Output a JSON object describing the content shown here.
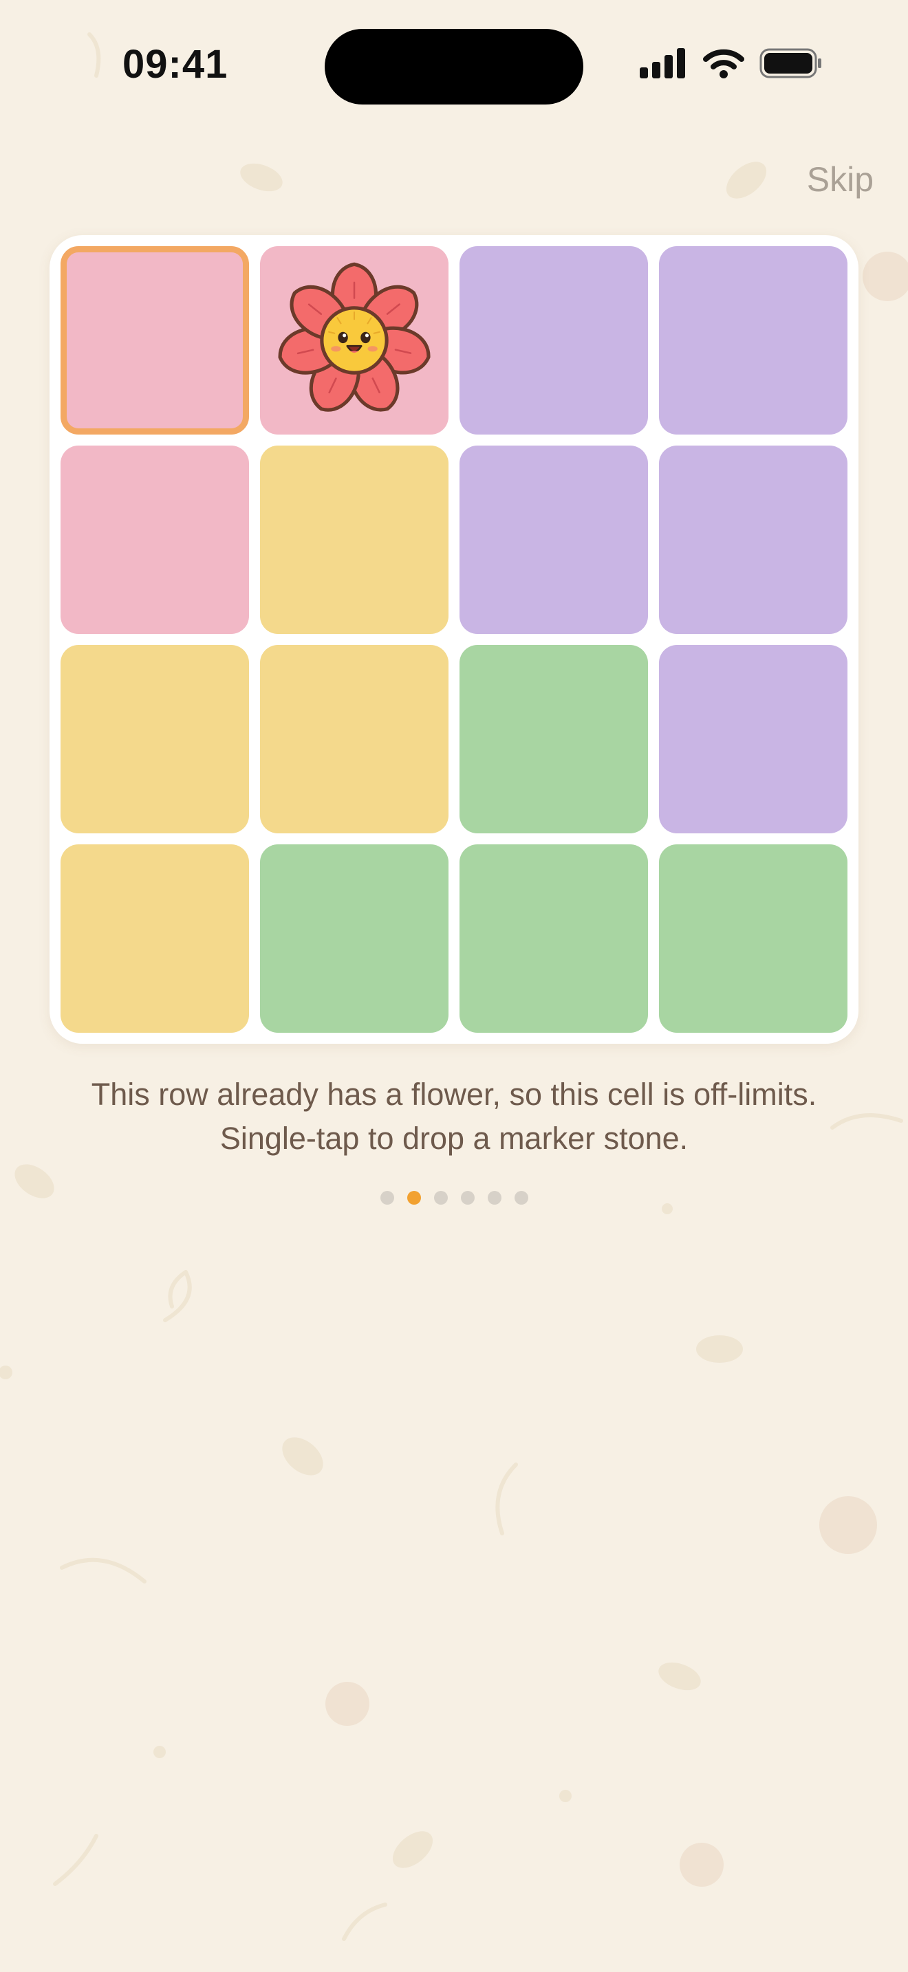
{
  "status_bar": {
    "time": "09:41"
  },
  "header": {
    "skip_label": "Skip"
  },
  "board": {
    "colors": {
      "pink": "#f2b8c6",
      "yellow": "#f4d98c",
      "purple": "#c9b5e4",
      "green": "#a8d5a2",
      "selected_border": "#f3a863"
    },
    "rows": [
      [
        {
          "color": "pink",
          "selected": true,
          "icon": ""
        },
        {
          "color": "pink",
          "selected": false,
          "icon": "flower-icon"
        },
        {
          "color": "purple",
          "selected": false,
          "icon": ""
        },
        {
          "color": "purple",
          "selected": false,
          "icon": ""
        }
      ],
      [
        {
          "color": "pink",
          "selected": false,
          "icon": ""
        },
        {
          "color": "yellow",
          "selected": false,
          "icon": ""
        },
        {
          "color": "purple",
          "selected": false,
          "icon": ""
        },
        {
          "color": "purple",
          "selected": false,
          "icon": ""
        }
      ],
      [
        {
          "color": "yellow",
          "selected": false,
          "icon": ""
        },
        {
          "color": "yellow",
          "selected": false,
          "icon": ""
        },
        {
          "color": "green",
          "selected": false,
          "icon": ""
        },
        {
          "color": "purple",
          "selected": false,
          "icon": ""
        }
      ],
      [
        {
          "color": "yellow",
          "selected": false,
          "icon": ""
        },
        {
          "color": "green",
          "selected": false,
          "icon": ""
        },
        {
          "color": "green",
          "selected": false,
          "icon": ""
        },
        {
          "color": "green",
          "selected": false,
          "icon": ""
        }
      ]
    ]
  },
  "hint": {
    "line1": "This row already has a flower, so this cell is off-limits.",
    "line2": "Single-tap to drop a marker stone."
  },
  "pager": {
    "count": 6,
    "active_index": 1,
    "active_color": "#f2a130"
  }
}
